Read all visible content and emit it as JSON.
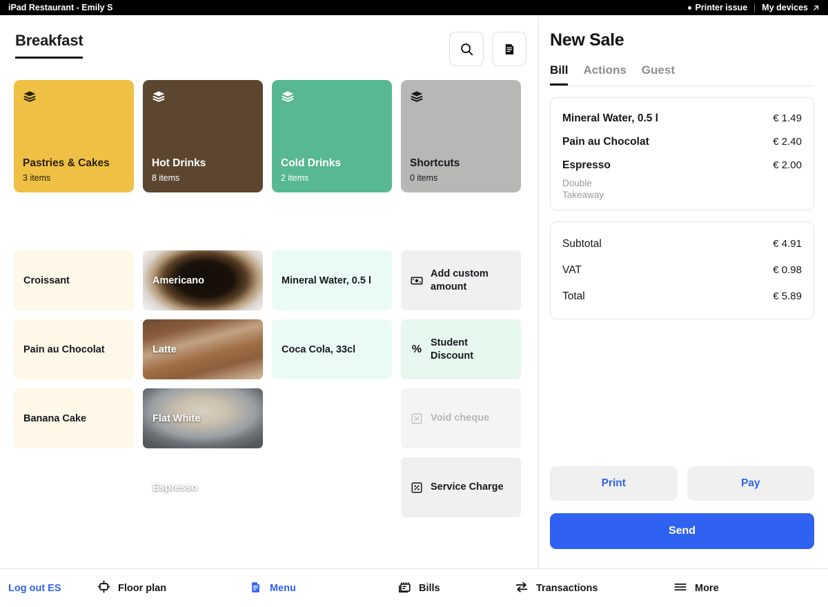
{
  "topbar": {
    "title": "iPad Restaurant - Emily S",
    "printer_status": "Printer issue",
    "my_devices": "My devices",
    "external_link_icon": "arrow-up-right-icon",
    "status_dot_icon": "status-dot-icon"
  },
  "menu": {
    "active_category_tab": "Breakfast",
    "search_icon": "search-icon",
    "notes_icon": "receipt-note-icon",
    "categories": [
      {
        "name": "Pastries & Cakes",
        "count": "3 items",
        "bg": "#EFC043",
        "fg": "#2a210a",
        "icon": "layers-stack-icon"
      },
      {
        "name": "Hot Drinks",
        "count": "8 items",
        "bg": "#5C462F",
        "fg": "#ffffff",
        "icon": "layers-stack-icon"
      },
      {
        "name": "Cold Drinks",
        "count": "2 items",
        "bg": "#57B892",
        "fg": "#ffffff",
        "icon": "layers-stack-icon"
      },
      {
        "name": "Shortcuts",
        "count": "0 items",
        "bg": "#B7B7B5",
        "fg": "#16181d",
        "icon": "layers-stack-icon"
      }
    ],
    "columns": [
      {
        "kind": "plain",
        "items": [
          {
            "label": "Croissant"
          },
          {
            "label": "Pain au Chocolat"
          },
          {
            "label": "Banana Cake"
          }
        ]
      },
      {
        "kind": "photo",
        "items": [
          {
            "label": "Americano"
          },
          {
            "label": "Latte"
          },
          {
            "label": "Flat White"
          },
          {
            "label": "Espresso"
          }
        ]
      },
      {
        "kind": "mint",
        "items": [
          {
            "label": "Mineral Water, 0.5 l"
          },
          {
            "label": "Coca Cola, 33cl"
          }
        ]
      },
      {
        "kind": "action",
        "items": [
          {
            "label": "Add custom amount",
            "icon": "banknote-icon",
            "state": "enabled",
            "bg": "#f0f0f0"
          },
          {
            "label": "Student Discount",
            "icon": "percent-icon",
            "state": "enabled",
            "bg": "#e6f7ee"
          },
          {
            "label": "Void cheque",
            "icon": "void-box-icon",
            "state": "disabled",
            "bg": "#f4f4f4"
          },
          {
            "label": "Service Charge",
            "icon": "percent-box-icon",
            "state": "enabled",
            "bg": "#f0f0f0"
          }
        ]
      }
    ]
  },
  "sale": {
    "title": "New Sale",
    "tabs": [
      {
        "label": "Bill",
        "active": true
      },
      {
        "label": "Actions",
        "active": false
      },
      {
        "label": "Guest",
        "active": false
      }
    ],
    "line_items": [
      {
        "name": "Mineral Water, 0.5 l",
        "price": "€ 1.49",
        "modifiers": []
      },
      {
        "name": "Pain au Chocolat",
        "price": "€ 2.40",
        "modifiers": []
      },
      {
        "name": "Espresso",
        "price": "€ 2.00",
        "modifiers": [
          "Double",
          "Takeaway"
        ]
      }
    ],
    "totals": [
      {
        "label": "Subtotal",
        "value": "€ 4.91"
      },
      {
        "label": "VAT",
        "value": "€ 0.98"
      },
      {
        "label": "Total",
        "value": "€ 5.89"
      }
    ],
    "print_label": "Print",
    "pay_label": "Pay",
    "send_label": "Send",
    "accent_color": "#2f62f0"
  },
  "bottom_nav": [
    {
      "label": "Log out ES",
      "icon": null,
      "style": "link"
    },
    {
      "label": "Floor plan",
      "icon": "floorplan-icon",
      "style": "normal"
    },
    {
      "label": "Menu",
      "icon": "clipboard-icon",
      "style": "active"
    },
    {
      "label": "Bills",
      "icon": "bills-icon",
      "style": "normal"
    },
    {
      "label": "Transactions",
      "icon": "transfer-icon",
      "style": "normal"
    },
    {
      "label": "More",
      "icon": "hamburger-icon",
      "style": "normal"
    }
  ]
}
